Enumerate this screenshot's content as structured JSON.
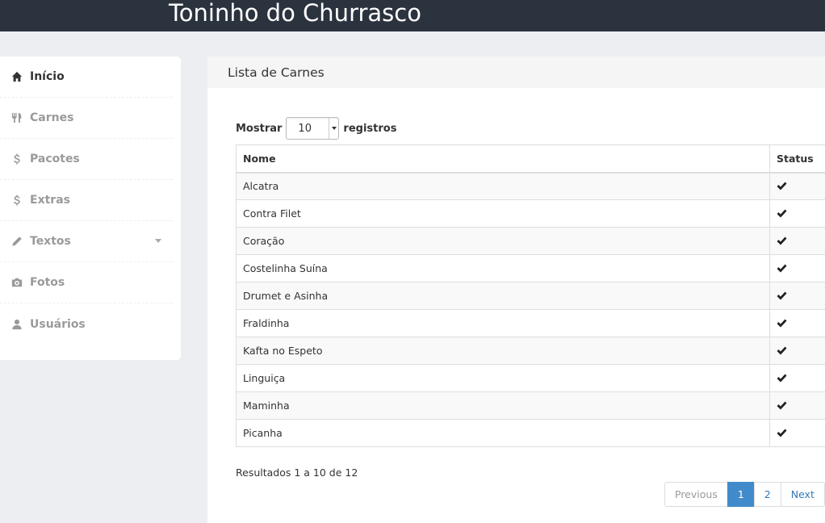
{
  "app": {
    "title": "Toninho do Churrasco"
  },
  "sidebar": {
    "items": [
      {
        "label": "Início",
        "icon": "home-icon"
      },
      {
        "label": "Carnes",
        "icon": "cutlery-icon"
      },
      {
        "label": "Pacotes",
        "icon": "dollar-icon"
      },
      {
        "label": "Extras",
        "icon": "dollar-icon"
      },
      {
        "label": "Textos",
        "icon": "pencil-icon"
      },
      {
        "label": "Fotos",
        "icon": "camera-icon"
      },
      {
        "label": "Usuários",
        "icon": "user-icon"
      }
    ]
  },
  "panel": {
    "title": "Lista de Carnes",
    "length": {
      "prefix": "Mostrar",
      "value": "10",
      "suffix": "registros"
    },
    "table": {
      "columns": [
        "Nome",
        "Status"
      ],
      "rows": [
        "Alcatra",
        "Contra Filet",
        "Coração",
        "Costelinha Suína",
        "Drumet e Asinha",
        "Fraldinha",
        "Kafta no Espeto",
        "Linguiça",
        "Maminha",
        "Picanha"
      ]
    },
    "info": "Resultados 1 a 10 de 12",
    "pagination": {
      "previous": "Previous",
      "pages": [
        "1",
        "2"
      ],
      "next": "Next"
    }
  },
  "colors": {
    "topbar": "#2b333e",
    "accent": "#428bca",
    "link": "#337ab7"
  }
}
